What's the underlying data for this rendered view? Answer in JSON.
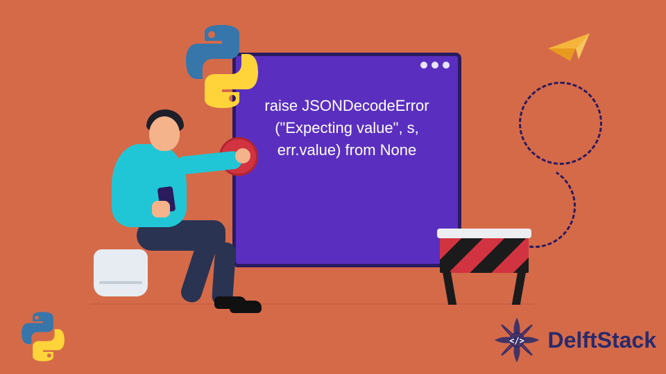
{
  "colors": {
    "background": "#d56a49",
    "window_bg": "#5a2fbf",
    "window_border": "#2a1b5e",
    "accent_cyan": "#21c6d6",
    "stop_red": "#d23340",
    "python_blue": "#3776AB",
    "python_yellow": "#FFD43B",
    "brand_navy": "#2a2a6a"
  },
  "window": {
    "error_text": "raise JSONDecodeError (\"Expecting value\", s, err.value) from None"
  },
  "icons": {
    "python_top": "python-logo",
    "python_bottom": "python-logo",
    "stop": "stop-icon",
    "paper_plane": "paper-plane-icon",
    "hazard_barrier": "hazard-barrier-icon",
    "mandala": "mandala-icon"
  },
  "brand": {
    "name": "DelftStack"
  }
}
